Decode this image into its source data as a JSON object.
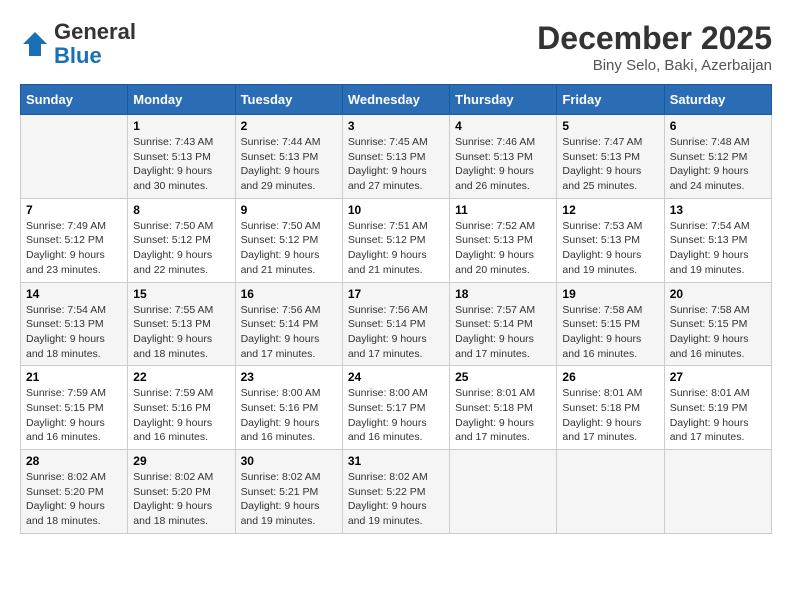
{
  "logo": {
    "general": "General",
    "blue": "Blue"
  },
  "title": "December 2025",
  "subtitle": "Biny Selo, Baki, Azerbaijan",
  "weekdays": [
    "Sunday",
    "Monday",
    "Tuesday",
    "Wednesday",
    "Thursday",
    "Friday",
    "Saturday"
  ],
  "weeks": [
    [
      {
        "num": "",
        "info": ""
      },
      {
        "num": "1",
        "info": "Sunrise: 7:43 AM\nSunset: 5:13 PM\nDaylight: 9 hours\nand 30 minutes."
      },
      {
        "num": "2",
        "info": "Sunrise: 7:44 AM\nSunset: 5:13 PM\nDaylight: 9 hours\nand 29 minutes."
      },
      {
        "num": "3",
        "info": "Sunrise: 7:45 AM\nSunset: 5:13 PM\nDaylight: 9 hours\nand 27 minutes."
      },
      {
        "num": "4",
        "info": "Sunrise: 7:46 AM\nSunset: 5:13 PM\nDaylight: 9 hours\nand 26 minutes."
      },
      {
        "num": "5",
        "info": "Sunrise: 7:47 AM\nSunset: 5:13 PM\nDaylight: 9 hours\nand 25 minutes."
      },
      {
        "num": "6",
        "info": "Sunrise: 7:48 AM\nSunset: 5:12 PM\nDaylight: 9 hours\nand 24 minutes."
      }
    ],
    [
      {
        "num": "7",
        "info": "Sunrise: 7:49 AM\nSunset: 5:12 PM\nDaylight: 9 hours\nand 23 minutes."
      },
      {
        "num": "8",
        "info": "Sunrise: 7:50 AM\nSunset: 5:12 PM\nDaylight: 9 hours\nand 22 minutes."
      },
      {
        "num": "9",
        "info": "Sunrise: 7:50 AM\nSunset: 5:12 PM\nDaylight: 9 hours\nand 21 minutes."
      },
      {
        "num": "10",
        "info": "Sunrise: 7:51 AM\nSunset: 5:12 PM\nDaylight: 9 hours\nand 21 minutes."
      },
      {
        "num": "11",
        "info": "Sunrise: 7:52 AM\nSunset: 5:13 PM\nDaylight: 9 hours\nand 20 minutes."
      },
      {
        "num": "12",
        "info": "Sunrise: 7:53 AM\nSunset: 5:13 PM\nDaylight: 9 hours\nand 19 minutes."
      },
      {
        "num": "13",
        "info": "Sunrise: 7:54 AM\nSunset: 5:13 PM\nDaylight: 9 hours\nand 19 minutes."
      }
    ],
    [
      {
        "num": "14",
        "info": "Sunrise: 7:54 AM\nSunset: 5:13 PM\nDaylight: 9 hours\nand 18 minutes."
      },
      {
        "num": "15",
        "info": "Sunrise: 7:55 AM\nSunset: 5:13 PM\nDaylight: 9 hours\nand 18 minutes."
      },
      {
        "num": "16",
        "info": "Sunrise: 7:56 AM\nSunset: 5:14 PM\nDaylight: 9 hours\nand 17 minutes."
      },
      {
        "num": "17",
        "info": "Sunrise: 7:56 AM\nSunset: 5:14 PM\nDaylight: 9 hours\nand 17 minutes."
      },
      {
        "num": "18",
        "info": "Sunrise: 7:57 AM\nSunset: 5:14 PM\nDaylight: 9 hours\nand 17 minutes."
      },
      {
        "num": "19",
        "info": "Sunrise: 7:58 AM\nSunset: 5:15 PM\nDaylight: 9 hours\nand 16 minutes."
      },
      {
        "num": "20",
        "info": "Sunrise: 7:58 AM\nSunset: 5:15 PM\nDaylight: 9 hours\nand 16 minutes."
      }
    ],
    [
      {
        "num": "21",
        "info": "Sunrise: 7:59 AM\nSunset: 5:15 PM\nDaylight: 9 hours\nand 16 minutes."
      },
      {
        "num": "22",
        "info": "Sunrise: 7:59 AM\nSunset: 5:16 PM\nDaylight: 9 hours\nand 16 minutes."
      },
      {
        "num": "23",
        "info": "Sunrise: 8:00 AM\nSunset: 5:16 PM\nDaylight: 9 hours\nand 16 minutes."
      },
      {
        "num": "24",
        "info": "Sunrise: 8:00 AM\nSunset: 5:17 PM\nDaylight: 9 hours\nand 16 minutes."
      },
      {
        "num": "25",
        "info": "Sunrise: 8:01 AM\nSunset: 5:18 PM\nDaylight: 9 hours\nand 17 minutes."
      },
      {
        "num": "26",
        "info": "Sunrise: 8:01 AM\nSunset: 5:18 PM\nDaylight: 9 hours\nand 17 minutes."
      },
      {
        "num": "27",
        "info": "Sunrise: 8:01 AM\nSunset: 5:19 PM\nDaylight: 9 hours\nand 17 minutes."
      }
    ],
    [
      {
        "num": "28",
        "info": "Sunrise: 8:02 AM\nSunset: 5:20 PM\nDaylight: 9 hours\nand 18 minutes."
      },
      {
        "num": "29",
        "info": "Sunrise: 8:02 AM\nSunset: 5:20 PM\nDaylight: 9 hours\nand 18 minutes."
      },
      {
        "num": "30",
        "info": "Sunrise: 8:02 AM\nSunset: 5:21 PM\nDaylight: 9 hours\nand 19 minutes."
      },
      {
        "num": "31",
        "info": "Sunrise: 8:02 AM\nSunset: 5:22 PM\nDaylight: 9 hours\nand 19 minutes."
      },
      {
        "num": "",
        "info": ""
      },
      {
        "num": "",
        "info": ""
      },
      {
        "num": "",
        "info": ""
      }
    ]
  ]
}
